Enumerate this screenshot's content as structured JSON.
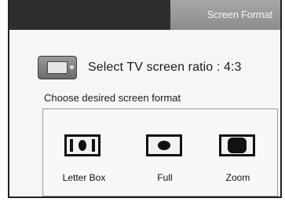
{
  "header": {
    "title": "Screen Format"
  },
  "ratio": {
    "icon": "tv-icon",
    "label": "Select TV screen ratio : 4:3"
  },
  "formats": {
    "prompt": "Choose desired screen format",
    "options": [
      {
        "label": "Letter Box",
        "icon": "letterbox-format-icon"
      },
      {
        "label": "Full",
        "icon": "full-format-icon"
      },
      {
        "label": "Zoom",
        "icon": "zoom-format-icon"
      }
    ]
  },
  "colors": {
    "title_bar": "#2e2e2e",
    "title_tab": "#9a9a9a",
    "background": "#f6f6f6"
  }
}
